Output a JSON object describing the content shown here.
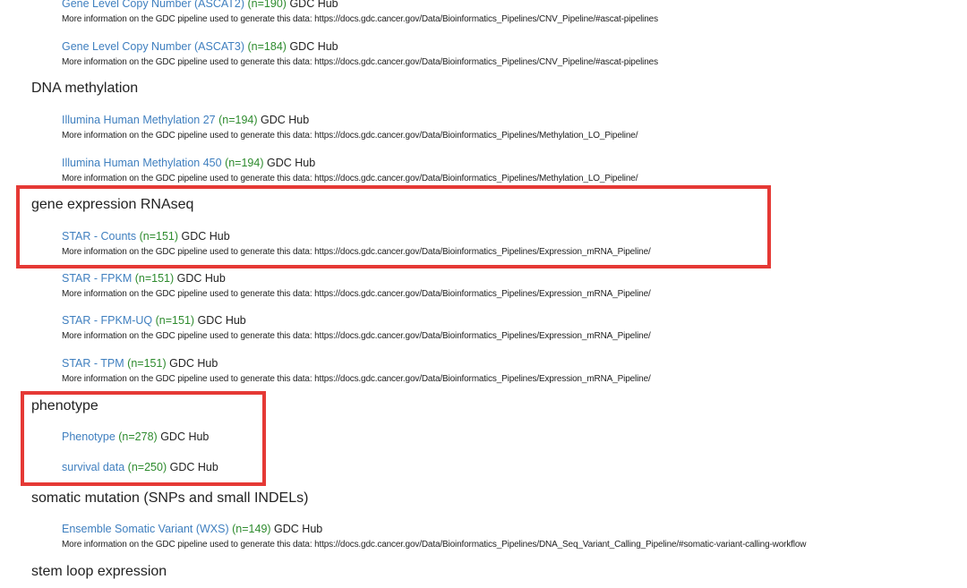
{
  "highlight_color": "#e53935",
  "link_color": "#3f7fbf",
  "count_color": "#2e8b2e",
  "info_prefix": "More information on the GDC pipeline used to generate this data: ",
  "sections": {
    "copy_number": {
      "items": [
        {
          "label": "Gene Level Copy Number (ASCAT2)",
          "count": "(n=190)",
          "hub": "GDC Hub",
          "info": "More information on the GDC pipeline used to generate this data: https://docs.gdc.cancer.gov/Data/Bioinformatics_Pipelines/CNV_Pipeline/#ascat-pipelines"
        },
        {
          "label": "Gene Level Copy Number (ASCAT3)",
          "count": "(n=184)",
          "hub": "GDC Hub",
          "info": "More information on the GDC pipeline used to generate this data: https://docs.gdc.cancer.gov/Data/Bioinformatics_Pipelines/CNV_Pipeline/#ascat-pipelines"
        }
      ]
    },
    "dna_methylation": {
      "title": "DNA methylation",
      "items": [
        {
          "label": "Illumina Human Methylation 27",
          "count": "(n=194)",
          "hub": "GDC Hub",
          "info": "More information on the GDC pipeline used to generate this data: https://docs.gdc.cancer.gov/Data/Bioinformatics_Pipelines/Methylation_LO_Pipeline/"
        },
        {
          "label": "Illumina Human Methylation 450",
          "count": "(n=194)",
          "hub": "GDC Hub",
          "info": "More information on the GDC pipeline used to generate this data: https://docs.gdc.cancer.gov/Data/Bioinformatics_Pipelines/Methylation_LO_Pipeline/"
        }
      ]
    },
    "gene_expression": {
      "title": "gene expression RNAseq",
      "items": [
        {
          "label": "STAR - Counts",
          "count": "(n=151)",
          "hub": "GDC Hub",
          "info": "More information on the GDC pipeline used to generate this data: https://docs.gdc.cancer.gov/Data/Bioinformatics_Pipelines/Expression_mRNA_Pipeline/"
        },
        {
          "label": "STAR - FPKM",
          "count": "(n=151)",
          "hub": "GDC Hub",
          "info": "More information on the GDC pipeline used to generate this data: https://docs.gdc.cancer.gov/Data/Bioinformatics_Pipelines/Expression_mRNA_Pipeline/"
        },
        {
          "label": "STAR - FPKM-UQ",
          "count": "(n=151)",
          "hub": "GDC Hub",
          "info": "More information on the GDC pipeline used to generate this data: https://docs.gdc.cancer.gov/Data/Bioinformatics_Pipelines/Expression_mRNA_Pipeline/"
        },
        {
          "label": "STAR - TPM",
          "count": "(n=151)",
          "hub": "GDC Hub",
          "info": "More information on the GDC pipeline used to generate this data: https://docs.gdc.cancer.gov/Data/Bioinformatics_Pipelines/Expression_mRNA_Pipeline/"
        }
      ]
    },
    "phenotype": {
      "title": "phenotype",
      "items": [
        {
          "label": "Phenotype",
          "count": "(n=278)",
          "hub": "GDC Hub"
        },
        {
          "label": "survival data",
          "count": "(n=250)",
          "hub": "GDC Hub"
        }
      ]
    },
    "somatic_mutation": {
      "title": "somatic mutation (SNPs and small INDELs)",
      "items": [
        {
          "label": "Ensemble Somatic Variant (WXS)",
          "count": "(n=149)",
          "hub": "GDC Hub",
          "info": "More information on the GDC pipeline used to generate this data: https://docs.gdc.cancer.gov/Data/Bioinformatics_Pipelines/DNA_Seq_Variant_Calling_Pipeline/#somatic-variant-calling-workflow"
        }
      ]
    },
    "stem_loop": {
      "title": "stem loop expression"
    }
  }
}
